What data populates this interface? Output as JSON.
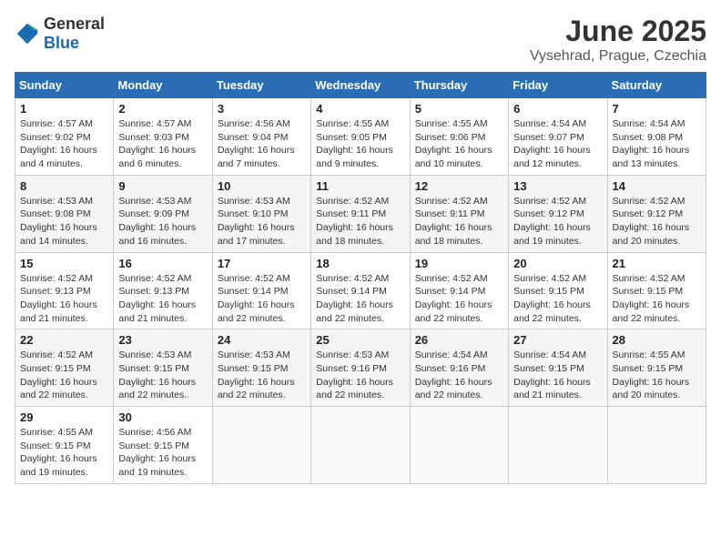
{
  "header": {
    "logo": {
      "general": "General",
      "blue": "Blue"
    },
    "month": "June 2025",
    "location": "Vysehrad, Prague, Czechia"
  },
  "calendar": {
    "days_of_week": [
      "Sunday",
      "Monday",
      "Tuesday",
      "Wednesday",
      "Thursday",
      "Friday",
      "Saturday"
    ],
    "weeks": [
      [
        null,
        null,
        null,
        null,
        null,
        null,
        null
      ]
    ],
    "cells": [
      [
        null,
        null,
        null,
        null,
        null,
        null,
        null
      ]
    ]
  },
  "days": [
    {
      "num": "1",
      "sunrise": "4:57 AM",
      "sunset": "9:02 PM",
      "daylight": "16 hours and 4 minutes."
    },
    {
      "num": "2",
      "sunrise": "4:57 AM",
      "sunset": "9:03 PM",
      "daylight": "16 hours and 6 minutes."
    },
    {
      "num": "3",
      "sunrise": "4:56 AM",
      "sunset": "9:04 PM",
      "daylight": "16 hours and 7 minutes."
    },
    {
      "num": "4",
      "sunrise": "4:55 AM",
      "sunset": "9:05 PM",
      "daylight": "16 hours and 9 minutes."
    },
    {
      "num": "5",
      "sunrise": "4:55 AM",
      "sunset": "9:06 PM",
      "daylight": "16 hours and 10 minutes."
    },
    {
      "num": "6",
      "sunrise": "4:54 AM",
      "sunset": "9:07 PM",
      "daylight": "16 hours and 12 minutes."
    },
    {
      "num": "7",
      "sunrise": "4:54 AM",
      "sunset": "9:08 PM",
      "daylight": "16 hours and 13 minutes."
    },
    {
      "num": "8",
      "sunrise": "4:53 AM",
      "sunset": "9:08 PM",
      "daylight": "16 hours and 14 minutes."
    },
    {
      "num": "9",
      "sunrise": "4:53 AM",
      "sunset": "9:09 PM",
      "daylight": "16 hours and 16 minutes."
    },
    {
      "num": "10",
      "sunrise": "4:53 AM",
      "sunset": "9:10 PM",
      "daylight": "16 hours and 17 minutes."
    },
    {
      "num": "11",
      "sunrise": "4:52 AM",
      "sunset": "9:11 PM",
      "daylight": "16 hours and 18 minutes."
    },
    {
      "num": "12",
      "sunrise": "4:52 AM",
      "sunset": "9:11 PM",
      "daylight": "16 hours and 18 minutes."
    },
    {
      "num": "13",
      "sunrise": "4:52 AM",
      "sunset": "9:12 PM",
      "daylight": "16 hours and 19 minutes."
    },
    {
      "num": "14",
      "sunrise": "4:52 AM",
      "sunset": "9:12 PM",
      "daylight": "16 hours and 20 minutes."
    },
    {
      "num": "15",
      "sunrise": "4:52 AM",
      "sunset": "9:13 PM",
      "daylight": "16 hours and 21 minutes."
    },
    {
      "num": "16",
      "sunrise": "4:52 AM",
      "sunset": "9:13 PM",
      "daylight": "16 hours and 21 minutes."
    },
    {
      "num": "17",
      "sunrise": "4:52 AM",
      "sunset": "9:14 PM",
      "daylight": "16 hours and 22 minutes."
    },
    {
      "num": "18",
      "sunrise": "4:52 AM",
      "sunset": "9:14 PM",
      "daylight": "16 hours and 22 minutes."
    },
    {
      "num": "19",
      "sunrise": "4:52 AM",
      "sunset": "9:14 PM",
      "daylight": "16 hours and 22 minutes."
    },
    {
      "num": "20",
      "sunrise": "4:52 AM",
      "sunset": "9:15 PM",
      "daylight": "16 hours and 22 minutes."
    },
    {
      "num": "21",
      "sunrise": "4:52 AM",
      "sunset": "9:15 PM",
      "daylight": "16 hours and 22 minutes."
    },
    {
      "num": "22",
      "sunrise": "4:52 AM",
      "sunset": "9:15 PM",
      "daylight": "16 hours and 22 minutes."
    },
    {
      "num": "23",
      "sunrise": "4:53 AM",
      "sunset": "9:15 PM",
      "daylight": "16 hours and 22 minutes."
    },
    {
      "num": "24",
      "sunrise": "4:53 AM",
      "sunset": "9:15 PM",
      "daylight": "16 hours and 22 minutes."
    },
    {
      "num": "25",
      "sunrise": "4:53 AM",
      "sunset": "9:16 PM",
      "daylight": "16 hours and 22 minutes."
    },
    {
      "num": "26",
      "sunrise": "4:54 AM",
      "sunset": "9:16 PM",
      "daylight": "16 hours and 22 minutes."
    },
    {
      "num": "27",
      "sunrise": "4:54 AM",
      "sunset": "9:15 PM",
      "daylight": "16 hours and 21 minutes."
    },
    {
      "num": "28",
      "sunrise": "4:55 AM",
      "sunset": "9:15 PM",
      "daylight": "16 hours and 20 minutes."
    },
    {
      "num": "29",
      "sunrise": "4:55 AM",
      "sunset": "9:15 PM",
      "daylight": "16 hours and 19 minutes."
    },
    {
      "num": "30",
      "sunrise": "4:56 AM",
      "sunset": "9:15 PM",
      "daylight": "16 hours and 19 minutes."
    }
  ],
  "labels": {
    "sunrise": "Sunrise:",
    "sunset": "Sunset:",
    "daylight": "Daylight:"
  }
}
